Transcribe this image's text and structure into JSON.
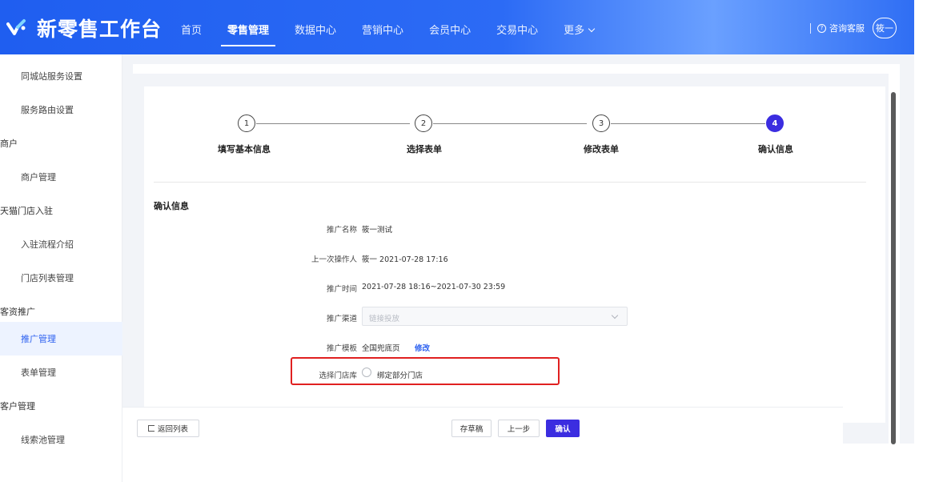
{
  "brand": {
    "title": "新零售工作台"
  },
  "nav": {
    "items": [
      "首页",
      "零售管理",
      "数据中心",
      "营销中心",
      "会员中心",
      "交易中心",
      "更多"
    ],
    "active_index": 1
  },
  "header_right": {
    "help": "咨询客服",
    "avatar": "筱一"
  },
  "sidebar": {
    "items": [
      {
        "label": "同城站服务设置",
        "kind": "child"
      },
      {
        "label": "服务路由设置",
        "kind": "child"
      },
      {
        "label": "商户",
        "kind": "group"
      },
      {
        "label": "商户管理",
        "kind": "child"
      },
      {
        "label": "天猫门店入驻",
        "kind": "group"
      },
      {
        "label": "入驻流程介绍",
        "kind": "child"
      },
      {
        "label": "门店列表管理",
        "kind": "child"
      },
      {
        "label": "客资推广",
        "kind": "group"
      },
      {
        "label": "推广管理",
        "kind": "child",
        "active": true
      },
      {
        "label": "表单管理",
        "kind": "child"
      },
      {
        "label": "客户管理",
        "kind": "group"
      },
      {
        "label": "线索池管理",
        "kind": "child"
      }
    ]
  },
  "steps": [
    {
      "num": "1",
      "label": "填写基本信息"
    },
    {
      "num": "2",
      "label": "选择表单"
    },
    {
      "num": "3",
      "label": "修改表单"
    },
    {
      "num": "4",
      "label": "确认信息",
      "current": true
    }
  ],
  "section": {
    "title": "确认信息"
  },
  "form": {
    "name_label": "推广名称",
    "name_value": "筱一测试",
    "operator_label": "上一次操作人",
    "operator_value": "筱一  2021-07-28 17:16",
    "time_label": "推广时间",
    "time_value": "2021-07-28 18:16~2021-07-30 23:59",
    "channel_label": "推广渠道",
    "channel_placeholder": "链接投放",
    "template_label": "推广模板",
    "template_value": "全国兜底页",
    "template_edit": "修改",
    "store_label": "选择门店库",
    "store_option": "绑定部分门店"
  },
  "footer": {
    "back": "返回列表",
    "draft": "存草稿",
    "prev": "上一步",
    "confirm": "确认"
  }
}
